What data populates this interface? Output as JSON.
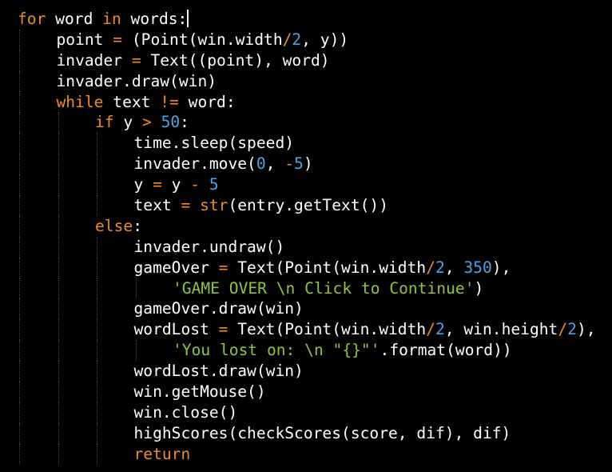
{
  "theme": {
    "background": "#000000",
    "colors": {
      "plain": "#ffffff",
      "keyword": "#f08c1e",
      "number": "#4aa3e8",
      "string": "#8ec63f",
      "operator": "#f08c1e",
      "builtin": "#f08c1e",
      "guide": "#4a4a4a"
    }
  },
  "editor": {
    "language": "python",
    "lines": [
      {
        "indent": 0,
        "cursor": true,
        "tokens": [
          {
            "t": "kw",
            "v": "for"
          },
          {
            "t": "p",
            "v": " word "
          },
          {
            "t": "kw",
            "v": "in"
          },
          {
            "t": "p",
            "v": " words:"
          }
        ]
      },
      {
        "indent": 1,
        "tokens": [
          {
            "t": "p",
            "v": "point "
          },
          {
            "t": "op",
            "v": "="
          },
          {
            "t": "p",
            "v": " (Point(win.width"
          },
          {
            "t": "op",
            "v": "/"
          },
          {
            "t": "num",
            "v": "2"
          },
          {
            "t": "p",
            "v": ", y))"
          }
        ]
      },
      {
        "indent": 1,
        "tokens": [
          {
            "t": "p",
            "v": "invader "
          },
          {
            "t": "op",
            "v": "="
          },
          {
            "t": "p",
            "v": " Text((point), word)"
          }
        ]
      },
      {
        "indent": 1,
        "tokens": [
          {
            "t": "p",
            "v": "invader.draw(win)"
          }
        ]
      },
      {
        "indent": 1,
        "tokens": [
          {
            "t": "kw",
            "v": "while"
          },
          {
            "t": "p",
            "v": " text "
          },
          {
            "t": "op",
            "v": "!="
          },
          {
            "t": "p",
            "v": " word:"
          }
        ]
      },
      {
        "indent": 2,
        "tokens": [
          {
            "t": "kw",
            "v": "if"
          },
          {
            "t": "p",
            "v": " y "
          },
          {
            "t": "op",
            "v": ">"
          },
          {
            "t": "p",
            "v": " "
          },
          {
            "t": "num",
            "v": "50"
          },
          {
            "t": "p",
            "v": ":"
          }
        ]
      },
      {
        "indent": 3,
        "tokens": [
          {
            "t": "p",
            "v": "time.sleep(speed)"
          }
        ]
      },
      {
        "indent": 3,
        "tokens": [
          {
            "t": "p",
            "v": "invader.move("
          },
          {
            "t": "num",
            "v": "0"
          },
          {
            "t": "p",
            "v": ", "
          },
          {
            "t": "op",
            "v": "-"
          },
          {
            "t": "num",
            "v": "5"
          },
          {
            "t": "p",
            "v": ")"
          }
        ]
      },
      {
        "indent": 3,
        "tokens": [
          {
            "t": "p",
            "v": "y "
          },
          {
            "t": "op",
            "v": "="
          },
          {
            "t": "p",
            "v": " y "
          },
          {
            "t": "op",
            "v": "-"
          },
          {
            "t": "p",
            "v": " "
          },
          {
            "t": "num",
            "v": "5"
          }
        ]
      },
      {
        "indent": 3,
        "tokens": [
          {
            "t": "p",
            "v": "text "
          },
          {
            "t": "op",
            "v": "="
          },
          {
            "t": "p",
            "v": " "
          },
          {
            "t": "bi",
            "v": "str"
          },
          {
            "t": "p",
            "v": "(entry.getText())"
          }
        ]
      },
      {
        "indent": 2,
        "tokens": [
          {
            "t": "kw",
            "v": "else"
          },
          {
            "t": "p",
            "v": ":"
          }
        ]
      },
      {
        "indent": 3,
        "tokens": [
          {
            "t": "p",
            "v": "invader.undraw()"
          }
        ]
      },
      {
        "indent": 3,
        "tokens": [
          {
            "t": "p",
            "v": "gameOver "
          },
          {
            "t": "op",
            "v": "="
          },
          {
            "t": "p",
            "v": " Text(Point(win.width"
          },
          {
            "t": "op",
            "v": "/"
          },
          {
            "t": "num",
            "v": "2"
          },
          {
            "t": "p",
            "v": ", "
          },
          {
            "t": "num",
            "v": "350"
          },
          {
            "t": "p",
            "v": "),"
          }
        ]
      },
      {
        "indent": 4,
        "tokens": [
          {
            "t": "str",
            "v": "'GAME OVER \\n Click to Continue'"
          },
          {
            "t": "p",
            "v": ")"
          }
        ]
      },
      {
        "indent": 3,
        "tokens": [
          {
            "t": "p",
            "v": "gameOver.draw(win)"
          }
        ]
      },
      {
        "indent": 3,
        "tokens": [
          {
            "t": "p",
            "v": "wordLost "
          },
          {
            "t": "op",
            "v": "="
          },
          {
            "t": "p",
            "v": " Text(Point(win.width"
          },
          {
            "t": "op",
            "v": "/"
          },
          {
            "t": "num",
            "v": "2"
          },
          {
            "t": "p",
            "v": ", win.height"
          },
          {
            "t": "op",
            "v": "/"
          },
          {
            "t": "num",
            "v": "2"
          },
          {
            "t": "p",
            "v": "),"
          }
        ]
      },
      {
        "indent": 4,
        "tokens": [
          {
            "t": "str",
            "v": "'You lost on: \\n \"{}\"'"
          },
          {
            "t": "p",
            "v": ".format(word))"
          }
        ]
      },
      {
        "indent": 3,
        "tokens": [
          {
            "t": "p",
            "v": "wordLost.draw(win)"
          }
        ]
      },
      {
        "indent": 3,
        "tokens": [
          {
            "t": "p",
            "v": "win.getMouse()"
          }
        ]
      },
      {
        "indent": 3,
        "tokens": [
          {
            "t": "p",
            "v": "win.close()"
          }
        ]
      },
      {
        "indent": 3,
        "tokens": [
          {
            "t": "p",
            "v": "highScores(checkScores(score, dif), dif)"
          }
        ]
      },
      {
        "indent": 3,
        "tokens": [
          {
            "t": "kw",
            "v": "return"
          }
        ]
      }
    ]
  }
}
